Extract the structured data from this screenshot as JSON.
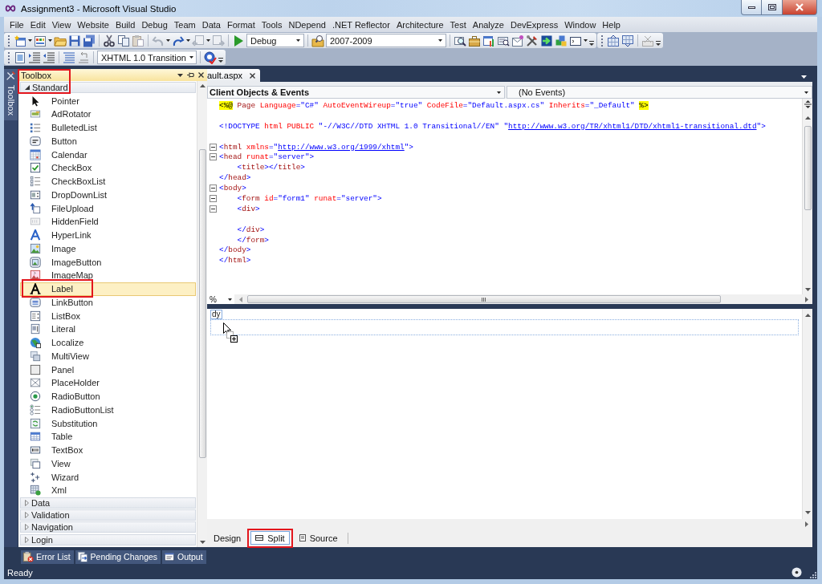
{
  "window": {
    "title": "Assignment3 - Microsoft Visual Studio"
  },
  "menu": [
    "File",
    "Edit",
    "View",
    "Website",
    "Build",
    "Debug",
    "Team",
    "Data",
    "Format",
    "Tools",
    "NDepend",
    ".NET Reflector",
    "Architecture",
    "Test",
    "Analyze",
    "DevExpress",
    "Window",
    "Help"
  ],
  "toolbar": {
    "configuration": "Debug",
    "find": "2007-2009",
    "target_schema": "XHTML 1.0 Transition"
  },
  "side_tab": "Toolbox",
  "toolbox": {
    "title": "Toolbox",
    "marked": true,
    "groups": [
      {
        "label": "Standard",
        "expanded": true,
        "items": [
          {
            "label": "Pointer",
            "kind": "pointer",
            "selected": false,
            "marked": false
          },
          {
            "label": "AdRotator",
            "kind": "adrotator",
            "selected": false,
            "marked": false
          },
          {
            "label": "BulletedList",
            "kind": "bulletedlist",
            "selected": false,
            "marked": false
          },
          {
            "label": "Button",
            "kind": "button",
            "selected": false,
            "marked": false
          },
          {
            "label": "Calendar",
            "kind": "calendar",
            "selected": false,
            "marked": false
          },
          {
            "label": "CheckBox",
            "kind": "checkbox",
            "selected": false,
            "marked": false
          },
          {
            "label": "CheckBoxList",
            "kind": "checkboxlist",
            "selected": false,
            "marked": false
          },
          {
            "label": "DropDownList",
            "kind": "dropdownlist",
            "selected": false,
            "marked": false
          },
          {
            "label": "FileUpload",
            "kind": "fileupload",
            "selected": false,
            "marked": false
          },
          {
            "label": "HiddenField",
            "kind": "hiddenfield",
            "selected": false,
            "marked": false
          },
          {
            "label": "HyperLink",
            "kind": "hyperlink",
            "selected": false,
            "marked": false
          },
          {
            "label": "Image",
            "kind": "image",
            "selected": false,
            "marked": false
          },
          {
            "label": "ImageButton",
            "kind": "imagebutton",
            "selected": false,
            "marked": false
          },
          {
            "label": "ImageMap",
            "kind": "imagemap",
            "selected": false,
            "marked": false
          },
          {
            "label": "Label",
            "kind": "label",
            "selected": true,
            "marked": true
          },
          {
            "label": "LinkButton",
            "kind": "linkbutton",
            "selected": false,
            "marked": false
          },
          {
            "label": "ListBox",
            "kind": "listbox",
            "selected": false,
            "marked": false
          },
          {
            "label": "Literal",
            "kind": "literal",
            "selected": false,
            "marked": false
          },
          {
            "label": "Localize",
            "kind": "localize",
            "selected": false,
            "marked": false
          },
          {
            "label": "MultiView",
            "kind": "multiview",
            "selected": false,
            "marked": false
          },
          {
            "label": "Panel",
            "kind": "panel",
            "selected": false,
            "marked": false
          },
          {
            "label": "PlaceHolder",
            "kind": "placeholder",
            "selected": false,
            "marked": false
          },
          {
            "label": "RadioButton",
            "kind": "radiobutton",
            "selected": false,
            "marked": false
          },
          {
            "label": "RadioButtonList",
            "kind": "radiobuttonlist",
            "selected": false,
            "marked": false
          },
          {
            "label": "Substitution",
            "kind": "substitution",
            "selected": false,
            "marked": false
          },
          {
            "label": "Table",
            "kind": "table",
            "selected": false,
            "marked": false
          },
          {
            "label": "TextBox",
            "kind": "textbox",
            "selected": false,
            "marked": false
          },
          {
            "label": "View",
            "kind": "view",
            "selected": false,
            "marked": false
          },
          {
            "label": "Wizard",
            "kind": "wizard",
            "selected": false,
            "marked": false
          },
          {
            "label": "Xml",
            "kind": "xml",
            "selected": false,
            "marked": false
          }
        ]
      },
      {
        "label": "Data",
        "expanded": false
      },
      {
        "label": "Validation",
        "expanded": false
      },
      {
        "label": "Navigation",
        "expanded": false
      },
      {
        "label": "Login",
        "expanded": false
      }
    ]
  },
  "document_tabs": [
    {
      "label": "ault.aspx",
      "selected": true
    }
  ],
  "navigation_bar": {
    "objects": "Client Objects & Events",
    "events": "(No Events)"
  },
  "editor": {
    "lines": [
      {
        "foldable": false,
        "tokens": [
          {
            "kind": "server",
            "text": "<%@"
          },
          {
            "kind": "element",
            "text": " Page"
          },
          {
            "kind": "attr",
            "text": " Language"
          },
          {
            "kind": "value",
            "text": "=\"C#\""
          },
          {
            "kind": "attr",
            "text": " AutoEventWireup"
          },
          {
            "kind": "value",
            "text": "=\"true\""
          },
          {
            "kind": "attr",
            "text": " CodeFile"
          },
          {
            "kind": "value",
            "text": "=\"Default.aspx.cs\""
          },
          {
            "kind": "attr",
            "text": " Inherits"
          },
          {
            "kind": "value",
            "text": "=\"_Default\" "
          },
          {
            "kind": "server",
            "text": "%>"
          }
        ]
      },
      {
        "foldable": false
      },
      {
        "foldable": false,
        "tokens": [
          {
            "kind": "delim",
            "text": "<!DOCTYPE"
          },
          {
            "kind": "attr",
            "text": " html PUBLIC"
          },
          {
            "kind": "value",
            "text": " \"-//W3C//DTD XHTML 1.0 Transitional//EN\" \""
          },
          {
            "kind": "link",
            "text": "http://www.w3.org/TR/xhtml1/DTD/xhtml1-transitional.dtd"
          },
          {
            "kind": "value",
            "text": "\">"
          }
        ]
      },
      {
        "foldable": false
      },
      {
        "foldable": true,
        "tokens": [
          {
            "kind": "delim",
            "text": "<"
          },
          {
            "kind": "element",
            "text": "html"
          },
          {
            "kind": "attr",
            "text": " xmlns"
          },
          {
            "kind": "value",
            "text": "=\""
          },
          {
            "kind": "link",
            "text": "http://www.w3.org/1999/xhtml"
          },
          {
            "kind": "value",
            "text": "\">"
          }
        ]
      },
      {
        "foldable": true,
        "tokens": [
          {
            "kind": "delim",
            "text": "<"
          },
          {
            "kind": "element",
            "text": "head"
          },
          {
            "kind": "attr",
            "text": " runat"
          },
          {
            "kind": "value",
            "text": "=\"server\">"
          }
        ]
      },
      {
        "foldable": false,
        "tokens": [
          {
            "kind": "delim",
            "text": "    <"
          },
          {
            "kind": "element",
            "text": "title"
          },
          {
            "kind": "delim",
            "text": "></"
          },
          {
            "kind": "element",
            "text": "title"
          },
          {
            "kind": "delim",
            "text": ">"
          }
        ]
      },
      {
        "foldable": false,
        "tokens": [
          {
            "kind": "delim",
            "text": "</"
          },
          {
            "kind": "element",
            "text": "head"
          },
          {
            "kind": "delim",
            "text": ">"
          }
        ]
      },
      {
        "foldable": true,
        "tokens": [
          {
            "kind": "delim",
            "text": "<"
          },
          {
            "kind": "element",
            "text": "body"
          },
          {
            "kind": "delim",
            "text": ">"
          }
        ]
      },
      {
        "foldable": true,
        "tokens": [
          {
            "kind": "delim",
            "text": "    <"
          },
          {
            "kind": "element",
            "text": "form"
          },
          {
            "kind": "attr",
            "text": " id"
          },
          {
            "kind": "value",
            "text": "=\"form1\""
          },
          {
            "kind": "attr",
            "text": " runat"
          },
          {
            "kind": "value",
            "text": "=\"server\">"
          }
        ]
      },
      {
        "foldable": true,
        "tokens": [
          {
            "kind": "delim",
            "text": "    <"
          },
          {
            "kind": "element",
            "text": "div"
          },
          {
            "kind": "delim",
            "text": ">"
          }
        ]
      },
      {
        "foldable": false
      },
      {
        "foldable": false,
        "tokens": [
          {
            "kind": "delim",
            "text": "    </"
          },
          {
            "kind": "element",
            "text": "div"
          },
          {
            "kind": "delim",
            "text": ">"
          }
        ]
      },
      {
        "foldable": false,
        "tokens": [
          {
            "kind": "delim",
            "text": "    </"
          },
          {
            "kind": "element",
            "text": "form"
          },
          {
            "kind": "delim",
            "text": ">"
          }
        ]
      },
      {
        "foldable": false,
        "tokens": [
          {
            "kind": "delim",
            "text": "</"
          },
          {
            "kind": "element",
            "text": "body"
          },
          {
            "kind": "delim",
            "text": ">"
          }
        ]
      },
      {
        "foldable": false,
        "tokens": [
          {
            "kind": "delim",
            "text": "</"
          },
          {
            "kind": "element",
            "text": "html"
          },
          {
            "kind": "delim",
            "text": ">"
          }
        ]
      }
    ],
    "zoom": "%"
  },
  "design_view": {
    "tag": "dy"
  },
  "view_tabs": [
    {
      "label": "Design",
      "kind": "design",
      "selected": false,
      "marked": false
    },
    {
      "label": "Split",
      "kind": "split",
      "selected": true,
      "marked": true
    },
    {
      "label": "Source",
      "kind": "source",
      "selected": false,
      "marked": false
    }
  ],
  "tool_windows": [
    {
      "label": "Error List",
      "kind": "errors"
    },
    {
      "label": "Pending Changes",
      "kind": "changes"
    },
    {
      "label": "Output",
      "kind": "output"
    }
  ],
  "status_bar": {
    "text": "Ready"
  }
}
